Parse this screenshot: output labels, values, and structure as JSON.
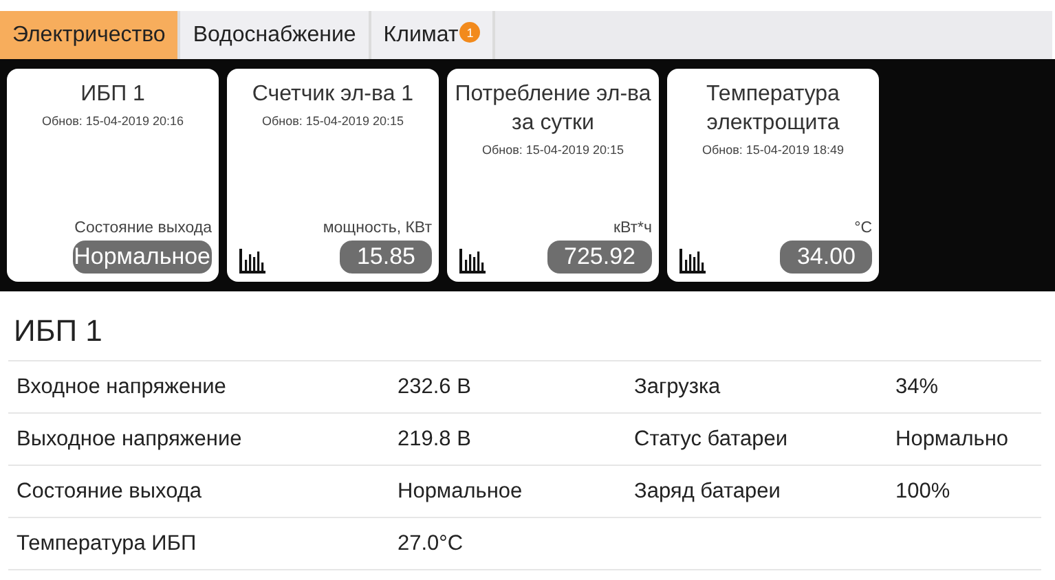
{
  "tabs": [
    {
      "label": "Электричество",
      "selected": true
    },
    {
      "label": "Водоснабжение",
      "selected": false
    },
    {
      "label": "Климат",
      "selected": false,
      "badge": "1"
    }
  ],
  "cards": [
    {
      "title": "ИБП 1",
      "updated": "Обнов: 15-04-2019 20:16",
      "caption": "Состояние выхода",
      "value": "Нормальное",
      "has_chart": false
    },
    {
      "title": "Счетчик эл-ва 1",
      "updated": "Обнов: 15-04-2019 20:15",
      "caption": "мощность, КВт",
      "value": "15.85",
      "has_chart": true
    },
    {
      "title": "Потребление эл-ва за сутки",
      "updated": "Обнов: 15-04-2019 20:15",
      "caption": "кВт*ч",
      "value": "725.92",
      "has_chart": true
    },
    {
      "title": "Температура электрощита",
      "updated": "Обнов: 15-04-2019 18:49",
      "caption": "°C",
      "value": "34.00",
      "has_chart": true
    }
  ],
  "details": {
    "title": "ИБП 1",
    "rows": [
      [
        "Входное напряжение",
        "232.6 В",
        "Загрузка",
        "34%"
      ],
      [
        "Выходное напряжение",
        "219.8 В",
        "Статус батареи",
        "Нормально"
      ],
      [
        "Состояние выхода",
        "Нормальное",
        "Заряд батареи",
        "100%"
      ],
      [
        "Температура ИБП",
        "27.0°C"
      ]
    ]
  }
}
